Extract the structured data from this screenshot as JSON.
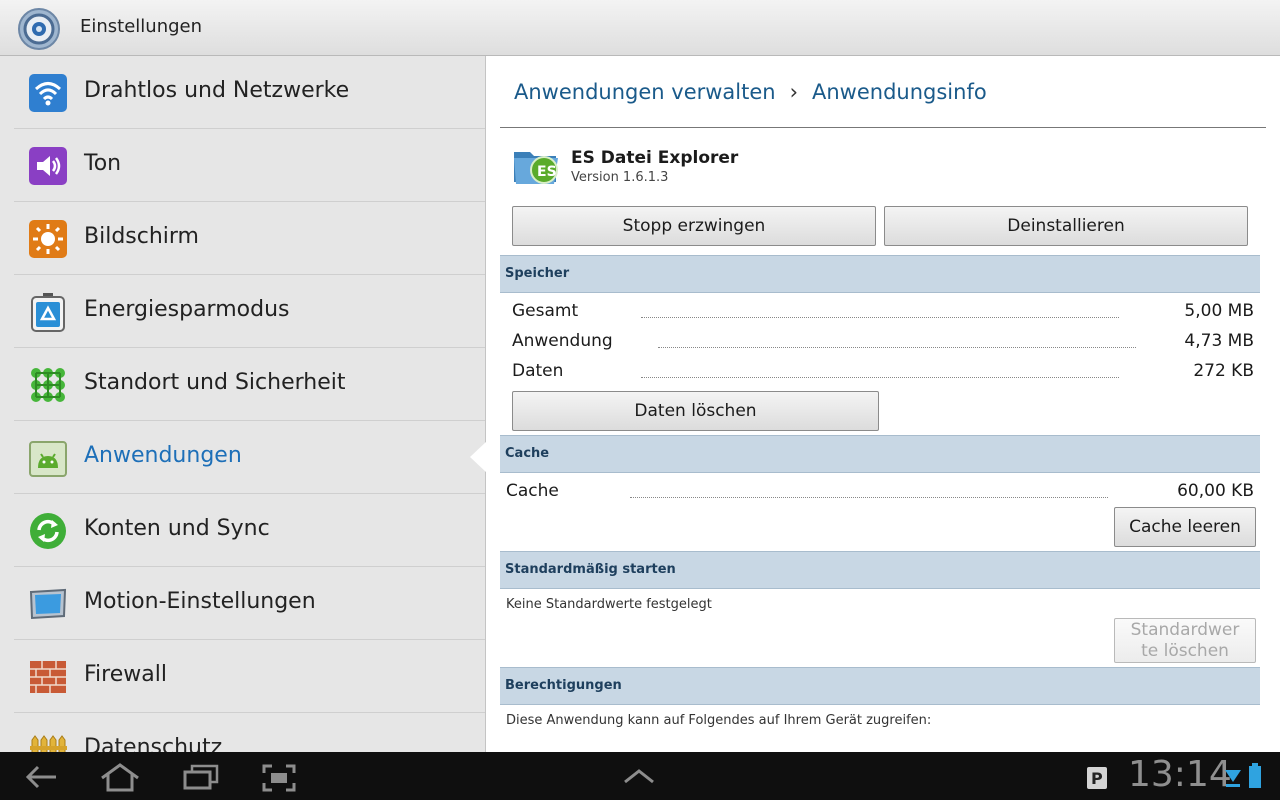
{
  "titlebar": {
    "title": "Einstellungen"
  },
  "sidebar": {
    "items": [
      {
        "label": "Drahtlos und Netzwerke",
        "icon": "wifi-icon"
      },
      {
        "label": "Ton",
        "icon": "speaker-icon"
      },
      {
        "label": "Bildschirm",
        "icon": "brightness-icon"
      },
      {
        "label": "Energiesparmodus",
        "icon": "battery-recycle-icon"
      },
      {
        "label": "Standort und Sicherheit",
        "icon": "location-grid-icon"
      },
      {
        "label": "Anwendungen",
        "icon": "android-app-icon",
        "active": true
      },
      {
        "label": "Konten und Sync",
        "icon": "sync-icon"
      },
      {
        "label": "Motion-Einstellungen",
        "icon": "motion-tablet-icon"
      },
      {
        "label": "Firewall",
        "icon": "brick-wall-icon"
      },
      {
        "label": "Datenschutz",
        "icon": "fence-icon"
      }
    ]
  },
  "main": {
    "breadcrumb": {
      "parent": "Anwendungen verwalten",
      "separator": "›",
      "current": "Anwendungsinfo"
    },
    "app": {
      "name": "ES Datei Explorer",
      "version": "Version 1.6.1.3",
      "icon": "es-file-explorer-icon"
    },
    "buttons": {
      "force_stop": "Stopp erzwingen",
      "uninstall": "Deinstallieren"
    },
    "storage": {
      "title": "Speicher",
      "rows": [
        {
          "label": "Gesamt",
          "value": "5,00 MB"
        },
        {
          "label": "Anwendung",
          "value": "4,73 MB"
        },
        {
          "label": "Daten",
          "value": "272 KB"
        }
      ],
      "clear_data": "Daten löschen"
    },
    "cache": {
      "title": "Cache",
      "row": {
        "label": "Cache",
        "value": "60,00 KB"
      },
      "clear_cache": "Cache leeren"
    },
    "defaults": {
      "title": "Standardmäßig starten",
      "text": "Keine Standardwerte festgelegt",
      "clear_defaults_line1": "Standardwer",
      "clear_defaults_line2": "te löschen"
    },
    "permissions": {
      "title": "Berechtigungen",
      "text": "Diese Anwendung kann auf Folgendes auf Ihrem Gerät zugreifen:"
    }
  },
  "systembar": {
    "clock": "13:14"
  },
  "colors": {
    "accent": "#1d6fb8",
    "section_bg": "#c8d7e4",
    "systembar_bg": "#0f0f0f"
  }
}
